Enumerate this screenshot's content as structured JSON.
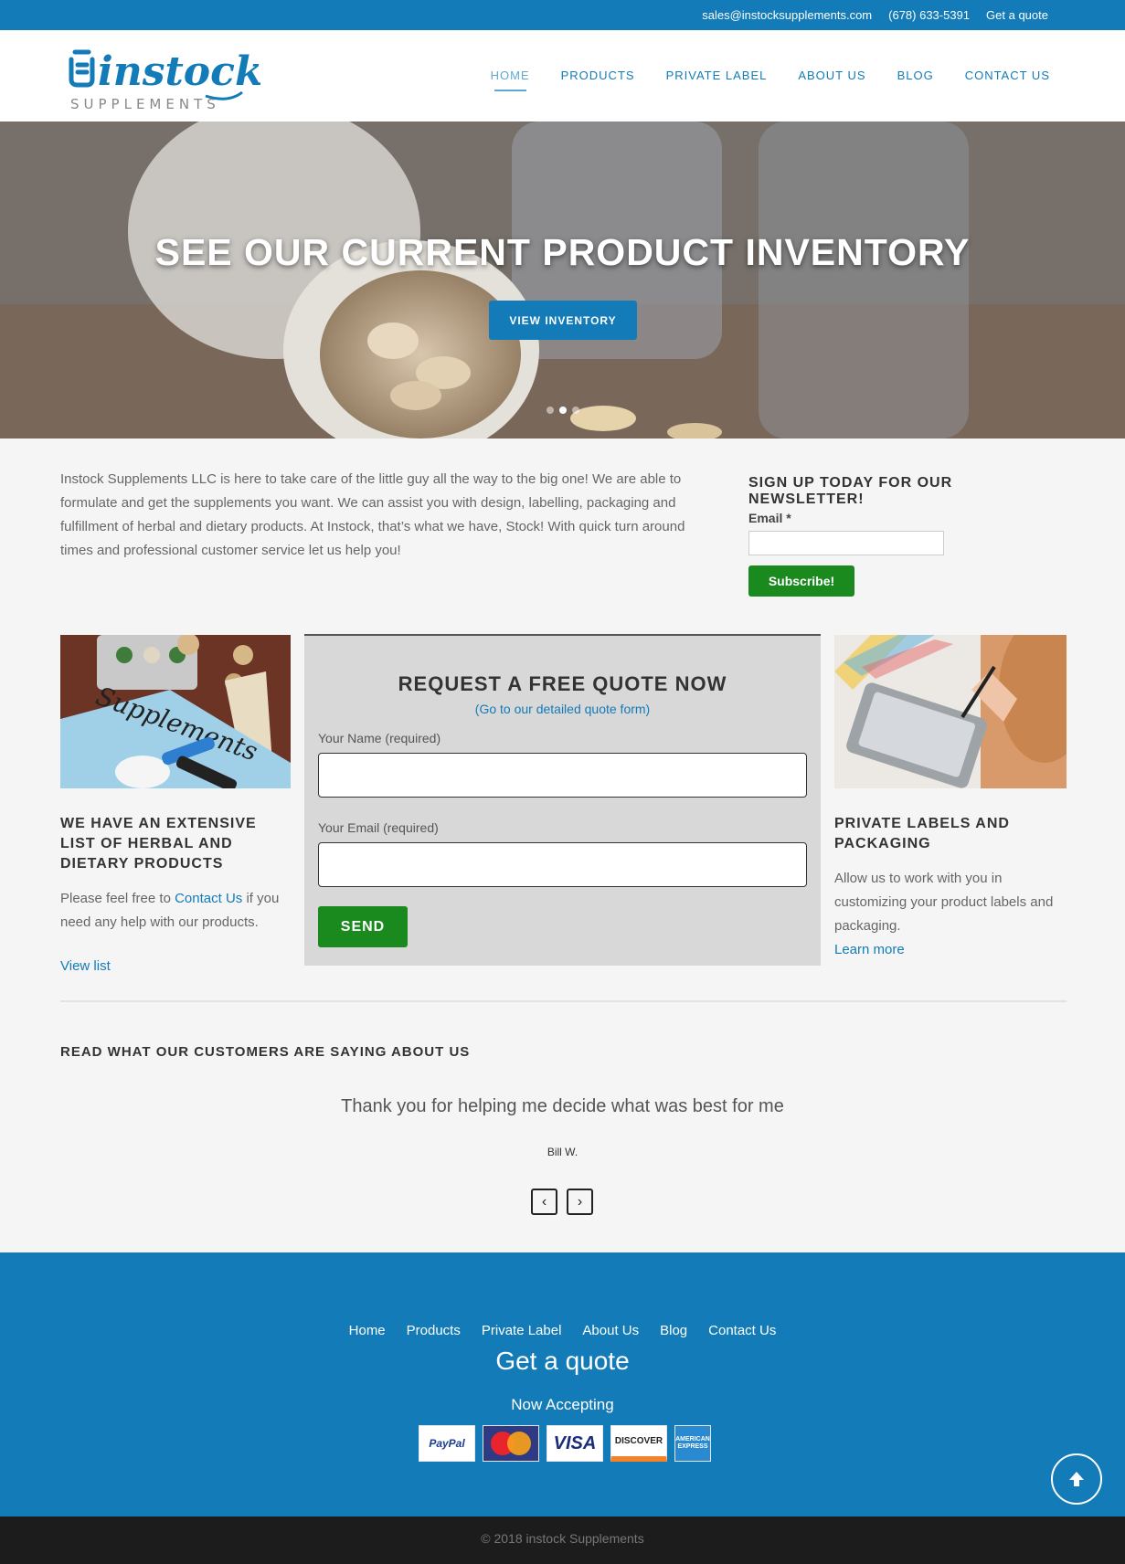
{
  "topbar": {
    "email": "sales@instocksupplements.com",
    "phone": "(678) 633-5391",
    "quote": "Get a quote"
  },
  "logo": {
    "brand": "instock",
    "sub": "SUPPLEMENTS"
  },
  "nav": {
    "items": [
      "HOME",
      "PRODUCTS",
      "PRIVATE LABEL",
      "ABOUT US",
      "BLOG",
      "CONTACT US"
    ],
    "active": "HOME"
  },
  "hero": {
    "title": "SEE OUR CURRENT PRODUCT INVENTORY",
    "button": "VIEW INVENTORY",
    "slide_count": 3,
    "active_slide": 2
  },
  "intro": {
    "text": "Instock Supplements LLC is here to take care of the little guy all the way to the big one! We are able to formulate and get the supplements you want. We can assist you with design, labelling, packaging and fulfillment of herbal and dietary products. At Instock, that’s what we have, Stock! With quick turn around times and professional customer service let us help you!"
  },
  "newsletter": {
    "title": "SIGN UP TODAY FOR OUR NEWSLETTER!",
    "email_label": "Email *",
    "email_value": "",
    "button": "Subscribe!"
  },
  "products_col": {
    "image_text": "Supplements",
    "title": "WE HAVE AN EXTENSIVE LIST OF HERBAL AND DIETARY PRODUCTS",
    "text_before": "Please feel free to ",
    "link": "Contact Us",
    "text_after": " if you need any help with our products.",
    "view_link": "View list"
  },
  "quote_form": {
    "title": "REQUEST A FREE QUOTE NOW",
    "detail_link": "(Go to our detailed quote form)",
    "name_label": "Your Name (required)",
    "name_value": "",
    "email_label": "Your Email (required)",
    "email_value": "",
    "button": "SEND"
  },
  "labels_col": {
    "title": "PRIVATE LABELS AND PACKAGING",
    "text": "Allow us to work with you in customizing your product labels and packaging.",
    "link": "Learn more"
  },
  "testimonials": {
    "heading": "READ WHAT OUR CUSTOMERS ARE SAYING ABOUT US",
    "quote": "Thank you for helping me decide what was best for me",
    "author": "Bill W.",
    "prev": "‹",
    "next": "›"
  },
  "footer": {
    "links": [
      "Home",
      "Products",
      "Private Label",
      "About Us",
      "Blog",
      "Contact Us"
    ],
    "quote": "Get a quote",
    "accepting": "Now Accepting",
    "cards": {
      "paypal": "PayPal",
      "mastercard": "MasterCard",
      "visa": "VISA",
      "discover": "DISCOVER",
      "amex": "AMERICAN EXPRESS"
    },
    "copyright": "© 2018 instock Supplements"
  },
  "colors": {
    "brand_blue": "#137bb7",
    "green_button": "#1a8a1f",
    "dark_footer": "#1c1c1c"
  },
  "icons": [
    "arrow-up-icon",
    "chevron-left-icon",
    "chevron-right-icon"
  ]
}
